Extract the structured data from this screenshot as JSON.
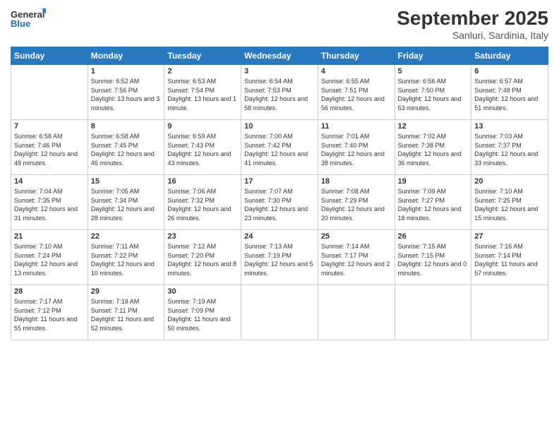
{
  "header": {
    "logo_line1": "General",
    "logo_line2": "Blue",
    "month_title": "September 2025",
    "location": "Sanluri, Sardinia, Italy"
  },
  "days_of_week": [
    "Sunday",
    "Monday",
    "Tuesday",
    "Wednesday",
    "Thursday",
    "Friday",
    "Saturday"
  ],
  "weeks": [
    [
      {
        "day": "",
        "sunrise": "",
        "sunset": "",
        "daylight": ""
      },
      {
        "day": "1",
        "sunrise": "Sunrise: 6:52 AM",
        "sunset": "Sunset: 7:56 PM",
        "daylight": "Daylight: 13 hours and 3 minutes."
      },
      {
        "day": "2",
        "sunrise": "Sunrise: 6:53 AM",
        "sunset": "Sunset: 7:54 PM",
        "daylight": "Daylight: 13 hours and 1 minute."
      },
      {
        "day": "3",
        "sunrise": "Sunrise: 6:54 AM",
        "sunset": "Sunset: 7:53 PM",
        "daylight": "Daylight: 12 hours and 58 minutes."
      },
      {
        "day": "4",
        "sunrise": "Sunrise: 6:55 AM",
        "sunset": "Sunset: 7:51 PM",
        "daylight": "Daylight: 12 hours and 56 minutes."
      },
      {
        "day": "5",
        "sunrise": "Sunrise: 6:56 AM",
        "sunset": "Sunset: 7:50 PM",
        "daylight": "Daylight: 12 hours and 53 minutes."
      },
      {
        "day": "6",
        "sunrise": "Sunrise: 6:57 AM",
        "sunset": "Sunset: 7:48 PM",
        "daylight": "Daylight: 12 hours and 51 minutes."
      }
    ],
    [
      {
        "day": "7",
        "sunrise": "Sunrise: 6:58 AM",
        "sunset": "Sunset: 7:46 PM",
        "daylight": "Daylight: 12 hours and 48 minutes."
      },
      {
        "day": "8",
        "sunrise": "Sunrise: 6:58 AM",
        "sunset": "Sunset: 7:45 PM",
        "daylight": "Daylight: 12 hours and 46 minutes."
      },
      {
        "day": "9",
        "sunrise": "Sunrise: 6:59 AM",
        "sunset": "Sunset: 7:43 PM",
        "daylight": "Daylight: 12 hours and 43 minutes."
      },
      {
        "day": "10",
        "sunrise": "Sunrise: 7:00 AM",
        "sunset": "Sunset: 7:42 PM",
        "daylight": "Daylight: 12 hours and 41 minutes."
      },
      {
        "day": "11",
        "sunrise": "Sunrise: 7:01 AM",
        "sunset": "Sunset: 7:40 PM",
        "daylight": "Daylight: 12 hours and 38 minutes."
      },
      {
        "day": "12",
        "sunrise": "Sunrise: 7:02 AM",
        "sunset": "Sunset: 7:38 PM",
        "daylight": "Daylight: 12 hours and 36 minutes."
      },
      {
        "day": "13",
        "sunrise": "Sunrise: 7:03 AM",
        "sunset": "Sunset: 7:37 PM",
        "daylight": "Daylight: 12 hours and 33 minutes."
      }
    ],
    [
      {
        "day": "14",
        "sunrise": "Sunrise: 7:04 AM",
        "sunset": "Sunset: 7:35 PM",
        "daylight": "Daylight: 12 hours and 31 minutes."
      },
      {
        "day": "15",
        "sunrise": "Sunrise: 7:05 AM",
        "sunset": "Sunset: 7:34 PM",
        "daylight": "Daylight: 12 hours and 28 minutes."
      },
      {
        "day": "16",
        "sunrise": "Sunrise: 7:06 AM",
        "sunset": "Sunset: 7:32 PM",
        "daylight": "Daylight: 12 hours and 26 minutes."
      },
      {
        "day": "17",
        "sunrise": "Sunrise: 7:07 AM",
        "sunset": "Sunset: 7:30 PM",
        "daylight": "Daylight: 12 hours and 23 minutes."
      },
      {
        "day": "18",
        "sunrise": "Sunrise: 7:08 AM",
        "sunset": "Sunset: 7:29 PM",
        "daylight": "Daylight: 12 hours and 20 minutes."
      },
      {
        "day": "19",
        "sunrise": "Sunrise: 7:09 AM",
        "sunset": "Sunset: 7:27 PM",
        "daylight": "Daylight: 12 hours and 18 minutes."
      },
      {
        "day": "20",
        "sunrise": "Sunrise: 7:10 AM",
        "sunset": "Sunset: 7:25 PM",
        "daylight": "Daylight: 12 hours and 15 minutes."
      }
    ],
    [
      {
        "day": "21",
        "sunrise": "Sunrise: 7:10 AM",
        "sunset": "Sunset: 7:24 PM",
        "daylight": "Daylight: 12 hours and 13 minutes."
      },
      {
        "day": "22",
        "sunrise": "Sunrise: 7:11 AM",
        "sunset": "Sunset: 7:22 PM",
        "daylight": "Daylight: 12 hours and 10 minutes."
      },
      {
        "day": "23",
        "sunrise": "Sunrise: 7:12 AM",
        "sunset": "Sunset: 7:20 PM",
        "daylight": "Daylight: 12 hours and 8 minutes."
      },
      {
        "day": "24",
        "sunrise": "Sunrise: 7:13 AM",
        "sunset": "Sunset: 7:19 PM",
        "daylight": "Daylight: 12 hours and 5 minutes."
      },
      {
        "day": "25",
        "sunrise": "Sunrise: 7:14 AM",
        "sunset": "Sunset: 7:17 PM",
        "daylight": "Daylight: 12 hours and 2 minutes."
      },
      {
        "day": "26",
        "sunrise": "Sunrise: 7:15 AM",
        "sunset": "Sunset: 7:15 PM",
        "daylight": "Daylight: 12 hours and 0 minutes."
      },
      {
        "day": "27",
        "sunrise": "Sunrise: 7:16 AM",
        "sunset": "Sunset: 7:14 PM",
        "daylight": "Daylight: 11 hours and 57 minutes."
      }
    ],
    [
      {
        "day": "28",
        "sunrise": "Sunrise: 7:17 AM",
        "sunset": "Sunset: 7:12 PM",
        "daylight": "Daylight: 11 hours and 55 minutes."
      },
      {
        "day": "29",
        "sunrise": "Sunrise: 7:18 AM",
        "sunset": "Sunset: 7:11 PM",
        "daylight": "Daylight: 11 hours and 52 minutes."
      },
      {
        "day": "30",
        "sunrise": "Sunrise: 7:19 AM",
        "sunset": "Sunset: 7:09 PM",
        "daylight": "Daylight: 11 hours and 50 minutes."
      },
      {
        "day": "",
        "sunrise": "",
        "sunset": "",
        "daylight": ""
      },
      {
        "day": "",
        "sunrise": "",
        "sunset": "",
        "daylight": ""
      },
      {
        "day": "",
        "sunrise": "",
        "sunset": "",
        "daylight": ""
      },
      {
        "day": "",
        "sunrise": "",
        "sunset": "",
        "daylight": ""
      }
    ]
  ]
}
